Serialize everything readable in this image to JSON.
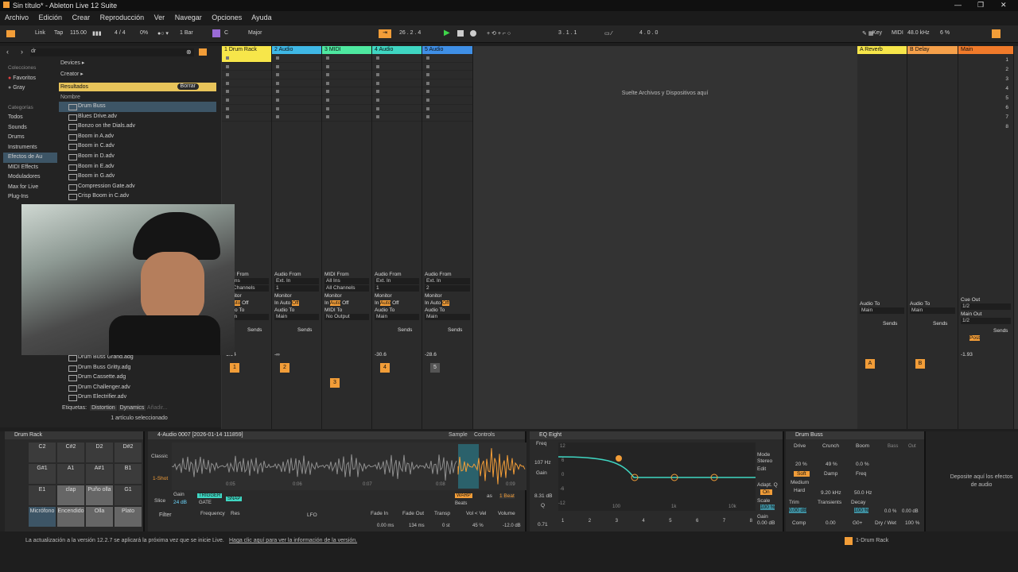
{
  "window": {
    "title": "Sin título* - Ableton Live 12 Suite"
  },
  "menu": [
    "Archivo",
    "Edición",
    "Crear",
    "Reproducción",
    "Ver",
    "Navegar",
    "Opciones",
    "Ayuda"
  ],
  "control": {
    "link": "Link",
    "tap": "Tap",
    "tempo": "115.00",
    "meter": "4 / 4",
    "cpu_pct": "0%",
    "quant": "1 Bar",
    "key": "C",
    "scale": "Major",
    "position": "26 . 2 . 4",
    "loop_start": "3 . 1 . 1",
    "loop_len": "4 . 0 . 0",
    "key_label": "Key",
    "midi_label": "MIDI",
    "sample_rate": "48.0 kHz",
    "cpu": "6 %"
  },
  "browser": {
    "search": "dr",
    "collections_label": "Colecciones",
    "collections": [
      "Favoritos",
      "Gray"
    ],
    "categories_label": "Categorías",
    "categories": [
      "Todos",
      "Sounds",
      "Drums",
      "Instruments",
      "Efectos de Au",
      "MIDI Effects",
      "Moduladores",
      "Max for Live",
      "Plug-Ins"
    ],
    "crumbs": [
      "Devices",
      "Creator"
    ],
    "results_label": "Resultados",
    "clear_label": "Borrar",
    "name_header": "Nombre",
    "files": [
      "Drum Buss",
      "Blues Drive.adv",
      "Bonzo on the Dials.adv",
      "Boom in A.adv",
      "Boom in C.adv",
      "Boom in D.adv",
      "Boom in E.adv",
      "Boom in G.adv",
      "Compression Gate.adv",
      "Crisp Boom in C.adv"
    ],
    "files_lower": [
      "Drum Buss Grand.adg",
      "Drum Buss Gritty.adg",
      "Drum Cassette.adg",
      "Drum Challenger.adv",
      "Drum Electrifier.adv"
    ],
    "tags_label": "Etiquetas:",
    "tags": [
      "Distortion",
      "Dynamics",
      "Añadir..."
    ],
    "selection_status": "1 artículo seleccionado"
  },
  "session": {
    "drop_hint": "Suelte Archivos y Dispositivos aquí",
    "tracks": [
      {
        "name": "1 Drum Rack",
        "color": "#f7e64a",
        "num": "1",
        "vol": "-1.94",
        "from": "MIDI From",
        "from_val": "All Ins",
        "ch": "All Channels",
        "to": "Main"
      },
      {
        "name": "2 Audio",
        "color": "#3fb8e6",
        "num": "2",
        "vol": "-∞",
        "from": "Audio From",
        "from_val": "Ext. In",
        "ch": "1",
        "to": "Main"
      },
      {
        "name": "3 MIDI",
        "color": "#4ee8a0",
        "num": "3",
        "vol": "",
        "from": "MIDI From",
        "from_val": "All Ins",
        "ch": "All Channels",
        "to": "No Output"
      },
      {
        "name": "4 Audio",
        "color": "#3fd6c2",
        "num": "4",
        "vol": "-30.6",
        "from": "Audio From",
        "from_val": "Ext. In",
        "ch": "1",
        "to": "Main"
      },
      {
        "name": "5 Audio",
        "color": "#3f8fe6",
        "num": "5",
        "vol": "-28.6",
        "from": "Audio From",
        "from_val": "Ext. In",
        "ch": "2",
        "to": "Main"
      }
    ],
    "returns": [
      {
        "name": "A Reverb",
        "color": "#f7e64a",
        "num": "A"
      },
      {
        "name": "B Delay",
        "color": "#f5a04a",
        "num": "B"
      },
      {
        "name": "Main",
        "color": "#f07a2a",
        "num": ""
      }
    ],
    "monitor_label": "Monitor",
    "audio_to": "Audio To",
    "midi_to": "MIDI To",
    "sends": "Sends",
    "in": "In",
    "auto": "Auto",
    "off": "Off",
    "cue_out": "Cue Out",
    "main_out": "Main Out",
    "out_val": "1/2",
    "main_vol": "-1.93",
    "post": "Post",
    "scene_nums": [
      "1",
      "2",
      "3",
      "4",
      "5",
      "6",
      "7",
      "8"
    ]
  },
  "devices": {
    "drum_rack": {
      "title": "Drum Rack",
      "pads": [
        "C2",
        "C#2",
        "D2",
        "D#2",
        "G#1",
        "A1",
        "A#1",
        "B1",
        "E1",
        "clap",
        "Puño olla",
        "G1",
        "Micrófono",
        "Encendido",
        "Olla",
        "Plato"
      ]
    },
    "sampler": {
      "title": "4-Audio 0007 [2026-01-14 111859]",
      "tabs": [
        "Sample",
        "Controls"
      ],
      "classic": "Classic",
      "oneshot": "1-Shot",
      "slice": "Slice",
      "gain_label": "Gain",
      "gain": "24 dB",
      "trigger": "TRIGGER",
      "gate": "GATE",
      "snap": "SNAP",
      "warp": "WARP",
      "beats": "Beats",
      "as": "as",
      "beat": "1 Beat",
      "filter": "Filter",
      "freq": "Frequency",
      "res": "Res",
      "lfo": "LFO",
      "fade_in": "Fade In",
      "fade_in_val": "0.00 ms",
      "fade_out": "Fade Out",
      "fade_out_val": "134 ms",
      "transp": "Transp",
      "transp_val": "0 st",
      "vel": "Vol < Vel",
      "vel_val": "45 %",
      "volume": "Volume",
      "volume_val": "-12.0 dB",
      "ticks": [
        "0:05",
        "0:06",
        "0:07",
        "0:08",
        "0:09"
      ]
    },
    "eq": {
      "title": "EQ Eight",
      "freq": "Freq",
      "freq_val": "107 Hz",
      "gain": "Gain",
      "gain_val": "8.31 dB",
      "q": "Q",
      "q_val": "0.71",
      "mode": "Mode",
      "stereo": "Stereo",
      "edit": "Edit",
      "adapt": "Adapt. Q",
      "on": "On",
      "scale": "Scale",
      "scale_val": "100 %",
      "gain2": "Gain",
      "gain2_val": "0.00 dB",
      "y_ticks": [
        "12",
        "6",
        "0",
        "-6",
        "-12"
      ],
      "x_ticks": [
        "100",
        "1k",
        "10k"
      ],
      "bands": [
        "1",
        "2",
        "3",
        "4",
        "5",
        "6",
        "7",
        "8"
      ]
    },
    "buss": {
      "title": "Drum Buss",
      "drive": "Drive",
      "drive_val": "20 %",
      "crunch": "Crunch",
      "crunch_val": "49 %",
      "boom": "Boom",
      "boom_val": "0.0 %",
      "soft": "Soft",
      "medium": "Medium",
      "hard": "Hard",
      "damp": "Damp",
      "damp_val": "9.20 kHz",
      "freq": "Freq",
      "freq_val": "50.0 Hz",
      "trim": "Trim",
      "trim_val": "0.00 dB",
      "transients": "Transients",
      "transients_val": "0.00",
      "decay": "Decay",
      "decay_val": "100 %",
      "comp": "Comp",
      "g0": "G0+",
      "drywet": "Dry / Wet",
      "drywet_val": "100 %",
      "bass": "Bass",
      "out": "Out",
      "bass_val": "0.0 %",
      "out_val": "0.00 dB"
    },
    "drop": "Deposite aquí los efectos de audio"
  },
  "statusbar": {
    "message": "La actualización a la versión 12.2.7 se aplicará la próxima vez que se inicie Live.",
    "link": "Haga clic aquí para ver la información de la versión.",
    "track": "1-Drum Rack"
  }
}
